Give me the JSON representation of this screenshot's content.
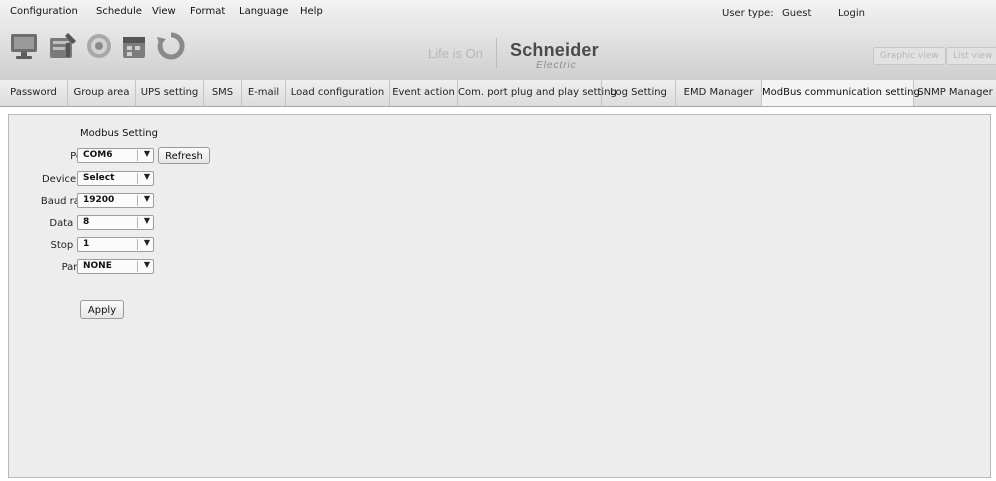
{
  "menu": [
    "Configuration",
    "Schedule",
    "View",
    "Format",
    "Language",
    "Help"
  ],
  "user": {
    "type_label": "User type:",
    "type_value": "Guest",
    "login_label": "Login"
  },
  "banner": {
    "tools": [
      "monitor-icon",
      "settings-tools-icon",
      "gear-icon",
      "calendar-icon",
      "refresh-icon"
    ],
    "slogan": "Life is On",
    "brand_name": "Schneider",
    "brand_sub": "Electric",
    "graphic_view": "Graphic view",
    "list_view": "List view"
  },
  "tabs": [
    "Password",
    "Group area",
    "UPS setting",
    "SMS",
    "E-mail",
    "Load configuration",
    "Event action",
    "Com. port plug and play setting",
    "Log Setting",
    "EMD Manager",
    "ModBus communication setting",
    "SNMP Manager"
  ],
  "active_tab": "ModBus communication setting",
  "modbus": {
    "title": "Modbus Setting",
    "port_label": "Port",
    "port_value": "COM6",
    "refresh_label": "Refresh",
    "device_label": "Device ID",
    "device_value": "Select",
    "baud_label": "Baud rate",
    "baud_value": "19200",
    "databit_label": "Data Bit",
    "databit_value": "8",
    "stopbit_label": "Stop Bit",
    "stopbit_value": "1",
    "parity_label": "Parity",
    "parity_value": "NONE",
    "apply_label": "Apply"
  },
  "colors": {
    "brand": "#4b4b4b",
    "active_tab": "#f4f4f4",
    "panel": "#ededed"
  }
}
